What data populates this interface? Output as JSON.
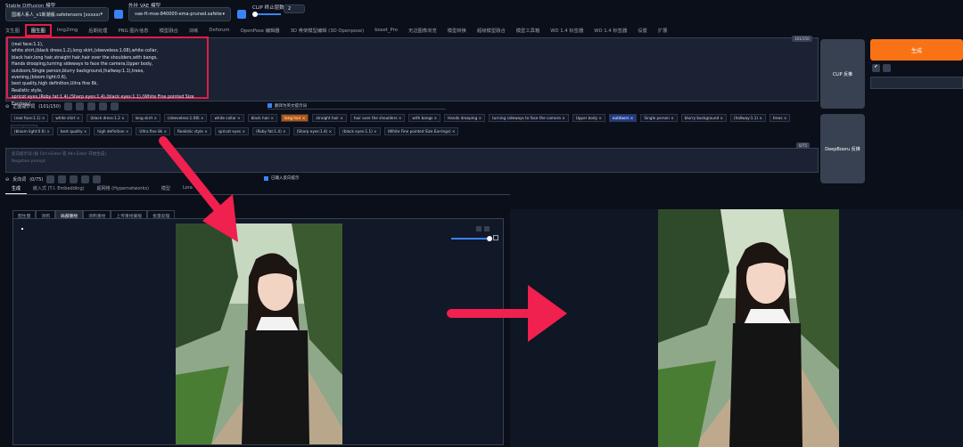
{
  "header": {
    "sd_model_label": "Stable Diffusion 模型",
    "sd_model_value": "国潮人系人_v1新潮版.safetensors [xxxxxxx]",
    "vae_label": "外挂 VAE 模型",
    "vae_value": "vae-ft-mse-840000-ema-pruned.safetensors",
    "clip_label": "CLIP 终止层数",
    "clip_value": "2"
  },
  "tabs": [
    "文生图",
    "图生图",
    "Img2img",
    "后期处理",
    "PNG 图片信息",
    "模型融合",
    "训练",
    "Deforum",
    "OpenPose 编辑器",
    "3D 骨架模型编辑 (3D Openpose)",
    "boset_Pro",
    "无边图像浏览",
    "模型转换",
    "超级模型融合",
    "模型工具箱",
    "WD 1.4 标签器",
    "WD 1.4 标签器",
    "设置",
    "扩展"
  ],
  "active_tab_index": 1,
  "prompt": {
    "counter": "101/150",
    "text": "(real face:1.1),\nwhite shirt,(black dress:1.2),long skirt,(sleeveless:1.08),white collar,\nblack hair,long hair,straight hair,hair over the shoulders,with bangs,\nHands drooping,turning sideways to face the camera,Upper body,\noutdoors,Single person,blurry background,(hallway:1.1),trees,\nevening,(bloom light:0.6),\nbest quality,high definition,Ultra fine 8k,\nRealistic style,\nspricot eyes,(Roby fat:1.4),(Sharp eyes:1.4),(black eyes:1.1),(White Fine pointed Size Earrings),"
  },
  "positive_section": {
    "label": "正面提示词",
    "count": "(101/150)",
    "checkbox_label": "翻译为英文提示词"
  },
  "tags_row1": [
    "(real face:1.1)",
    "white shirt",
    "(black dress:1.2",
    "long skirt",
    "(sleeveless:1.08)",
    "white collar",
    "black hair",
    "long hair",
    "straight hair",
    "hair over the shoulders",
    "with bangs",
    "Hands drooping",
    "turning sideways to face the camera",
    "Upper body",
    "outdoors",
    "Single person",
    "blurry background",
    "(hallway:1.1)",
    "trees",
    "evening"
  ],
  "tags_row2": [
    "(bloom light:0.6)",
    "best quality",
    "high definition",
    "Ultra fine 8k",
    "Realistic style",
    "spricot eyes",
    "(Roby fat:1.4)",
    "(Sharp eyes:1.4)",
    "(black eyes:1.1)",
    "(White Fine pointed Size Earrings)"
  ],
  "negative": {
    "placeholder": "反向提示词 (按 Ctrl+Enter 或 Alt+Enter 开始生成)",
    "sub_placeholder": "Negative prompt",
    "counter": "0/75",
    "label": "反向词",
    "count": "(0/75)",
    "checkbox_label": "已输入反向提示"
  },
  "side": {
    "clip_button": "CLIP 反推",
    "deepbooru_button": "DeepBooru 反推",
    "generate_button": "生成"
  },
  "subtabs": [
    "生成",
    "嵌入式 (T.I. Embedding)",
    "超网络 (Hypernetworks)",
    "模型",
    "Lora"
  ],
  "imgtabs": [
    "图生图",
    "涂鸦",
    "局部重绘",
    "涂鸦重绘",
    "上传重绘蒙版",
    "批量处理"
  ],
  "colors": {
    "accent_red": "#e11d48",
    "generate_orange": "#f97316",
    "background": "#0b0f19"
  }
}
